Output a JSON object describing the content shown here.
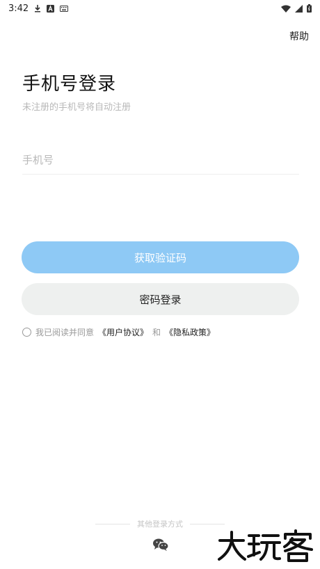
{
  "status_bar": {
    "time": "3:42",
    "left_icons": [
      "download-icon",
      "a-icon",
      "keyboard-icon"
    ],
    "right_icons": [
      "wifi-icon",
      "signal-icon",
      "battery-icon"
    ]
  },
  "header": {
    "help_label": "帮助"
  },
  "login": {
    "title": "手机号登录",
    "subtitle": "未注册的手机号将自动注册",
    "phone_placeholder": "手机号",
    "get_code_label": "获取验证码",
    "password_login_label": "密码登录"
  },
  "agreement": {
    "prefix": "我已阅读并同意",
    "user_agreement": "《用户协议》",
    "and": "和",
    "privacy_policy": "《隐私政策》"
  },
  "footer": {
    "other_login_label": "其他登录方式",
    "wechat_icon": "wechat-icon",
    "watermark_text": "大玩客"
  },
  "colors": {
    "primary_button": "#8ec9f5",
    "secondary_button": "#eef0ef",
    "placeholder": "#b8b8b8"
  }
}
